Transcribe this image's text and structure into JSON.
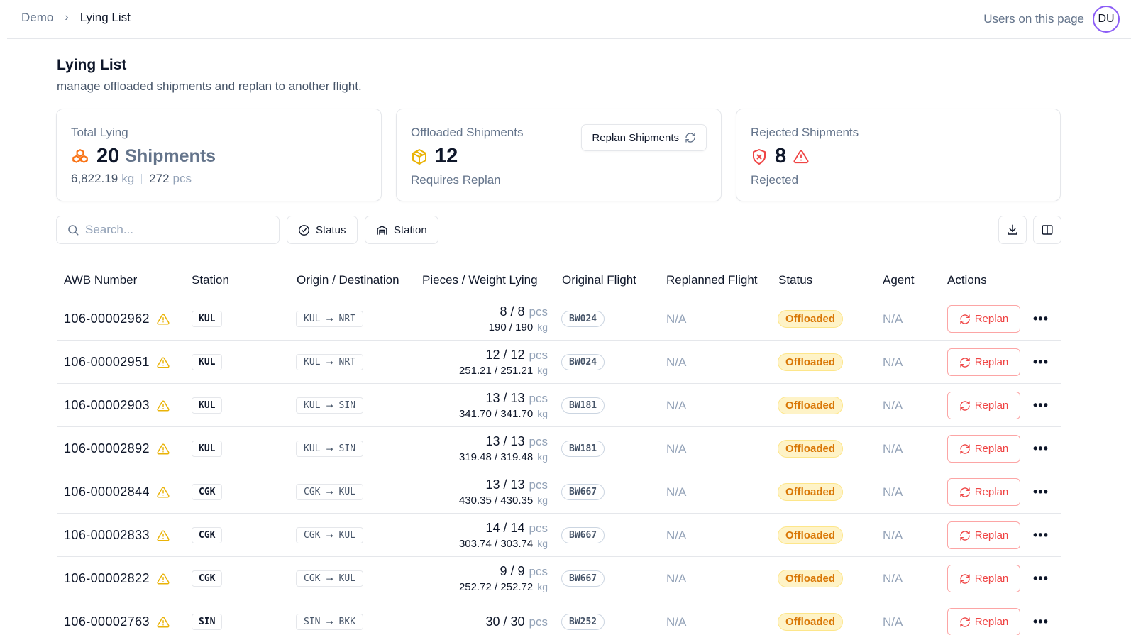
{
  "breadcrumb": {
    "parent": "Demo",
    "separator": "›",
    "current": "Lying List"
  },
  "presence": {
    "label": "Users on this page",
    "avatar": "DU"
  },
  "page": {
    "title": "Lying List",
    "subtitle": "manage offloaded shipments and replan to another flight."
  },
  "cards": {
    "total": {
      "label": "Total Lying",
      "value": "20",
      "unit": "Shipments",
      "weight": "6,822.19",
      "weight_unit": "kg",
      "pieces": "272",
      "pieces_unit": "pcs",
      "icon": "boxes-icon"
    },
    "offloaded": {
      "label": "Offloaded Shipments",
      "value": "12",
      "sub": "Requires Replan",
      "button": "Replan Shipments",
      "icon": "package-icon"
    },
    "rejected": {
      "label": "Rejected Shipments",
      "value": "8",
      "sub": "Rejected",
      "icon": "shield-x-icon"
    }
  },
  "toolbar": {
    "search_placeholder": "Search...",
    "status_filter": "Status",
    "station_filter": "Station"
  },
  "table": {
    "headers": {
      "awb": "AWB Number",
      "station": "Station",
      "route": "Origin / Destination",
      "pw": "Pieces / Weight Lying",
      "original": "Original Flight",
      "replanned": "Replanned Flight",
      "status": "Status",
      "agent": "Agent",
      "actions": "Actions"
    },
    "replan_label": "Replan",
    "more_label": "•••",
    "pcs_unit": "pcs",
    "kg_unit": "kg",
    "rows": [
      {
        "awb": "106-00002962",
        "station": "KUL",
        "origin": "KUL",
        "dest": "NRT",
        "pieces": "8 / 8",
        "weight": "190 / 190",
        "flight": "BW024",
        "replanned": "N/A",
        "status": "Offloaded",
        "agent": "N/A"
      },
      {
        "awb": "106-00002951",
        "station": "KUL",
        "origin": "KUL",
        "dest": "NRT",
        "pieces": "12 / 12",
        "weight": "251.21 / 251.21",
        "flight": "BW024",
        "replanned": "N/A",
        "status": "Offloaded",
        "agent": "N/A"
      },
      {
        "awb": "106-00002903",
        "station": "KUL",
        "origin": "KUL",
        "dest": "SIN",
        "pieces": "13 / 13",
        "weight": "341.70 / 341.70",
        "flight": "BW181",
        "replanned": "N/A",
        "status": "Offloaded",
        "agent": "N/A"
      },
      {
        "awb": "106-00002892",
        "station": "KUL",
        "origin": "KUL",
        "dest": "SIN",
        "pieces": "13 / 13",
        "weight": "319.48 / 319.48",
        "flight": "BW181",
        "replanned": "N/A",
        "status": "Offloaded",
        "agent": "N/A"
      },
      {
        "awb": "106-00002844",
        "station": "CGK",
        "origin": "CGK",
        "dest": "KUL",
        "pieces": "13 / 13",
        "weight": "430.35 / 430.35",
        "flight": "BW667",
        "replanned": "N/A",
        "status": "Offloaded",
        "agent": "N/A"
      },
      {
        "awb": "106-00002833",
        "station": "CGK",
        "origin": "CGK",
        "dest": "KUL",
        "pieces": "14 / 14",
        "weight": "303.74 / 303.74",
        "flight": "BW667",
        "replanned": "N/A",
        "status": "Offloaded",
        "agent": "N/A"
      },
      {
        "awb": "106-00002822",
        "station": "CGK",
        "origin": "CGK",
        "dest": "KUL",
        "pieces": "9 / 9",
        "weight": "252.72 / 252.72",
        "flight": "BW667",
        "replanned": "N/A",
        "status": "Offloaded",
        "agent": "N/A"
      },
      {
        "awb": "106-00002763",
        "station": "SIN",
        "origin": "SIN",
        "dest": "BKK",
        "pieces": "30 / 30",
        "weight": "",
        "flight": "BW252",
        "replanned": "N/A",
        "status": "Offloaded",
        "agent": "N/A"
      }
    ]
  },
  "colors": {
    "accent_red": "#ef4444",
    "warning": "#eab308",
    "offloaded_bg": "#fef3c7",
    "offloaded_text": "#d97706",
    "boxes_icon": "#f97316"
  }
}
